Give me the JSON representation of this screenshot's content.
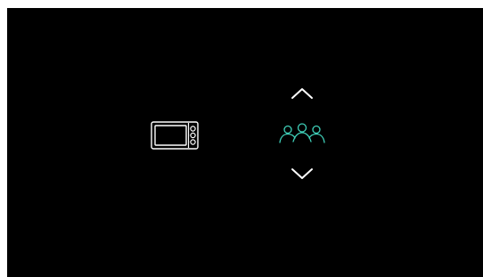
{
  "screen": {
    "background_color": "#000000",
    "appliance": {
      "icon": "microwave-icon",
      "color": "#ffffff"
    },
    "selector": {
      "up_icon": "chevron-up-icon",
      "current_icon": "people-group-icon",
      "down_icon": "chevron-down-icon",
      "arrow_color": "#ffffff",
      "accent_color": "#3fcfb8"
    }
  }
}
